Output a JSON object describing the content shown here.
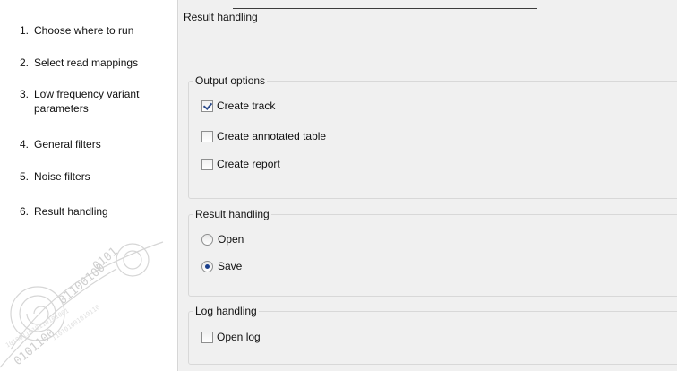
{
  "steps": [
    {
      "num": "1.",
      "label": "Choose where to run"
    },
    {
      "num": "2.",
      "label": "Select read mappings"
    },
    {
      "num": "3.",
      "label": "Low frequency variant parameters"
    },
    {
      "num": "4.",
      "label": "General filters"
    },
    {
      "num": "5.",
      "label": "Noise filters"
    },
    {
      "num": "6.",
      "label": "Result handling"
    }
  ],
  "page_title": "Result handling",
  "output_options": {
    "title": "Output options",
    "create_track": {
      "label": "Create track",
      "checked": true
    },
    "create_annotated_table": {
      "label": "Create annotated table",
      "checked": false
    },
    "create_report": {
      "label": "Create report",
      "checked": false
    }
  },
  "result_handling": {
    "title": "Result handling",
    "open": {
      "label": "Open",
      "selected": false
    },
    "save": {
      "label": "Save",
      "selected": true
    }
  },
  "log_handling": {
    "title": "Log handling",
    "open_log": {
      "label": "Open log",
      "checked": false
    }
  }
}
